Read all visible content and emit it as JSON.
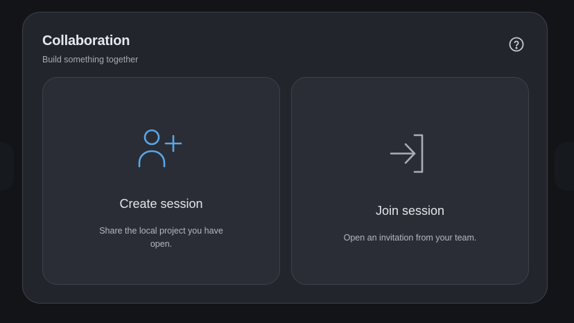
{
  "dialog": {
    "title": "Collaboration",
    "subtitle": "Build something together",
    "help_icon": "help-circle-icon"
  },
  "options": [
    {
      "icon": "user-plus-icon",
      "icon_color": "#5aa6e8",
      "title": "Create session",
      "description": "Share the local project you have open."
    },
    {
      "icon": "sign-in-icon",
      "icon_color": "#a9adb5",
      "title": "Join session",
      "description": "Open an invitation from your team."
    }
  ],
  "colors": {
    "background": "#121418",
    "dialog": "#22252c",
    "card": "#2a2d35",
    "accent": "#5aa6e8"
  }
}
